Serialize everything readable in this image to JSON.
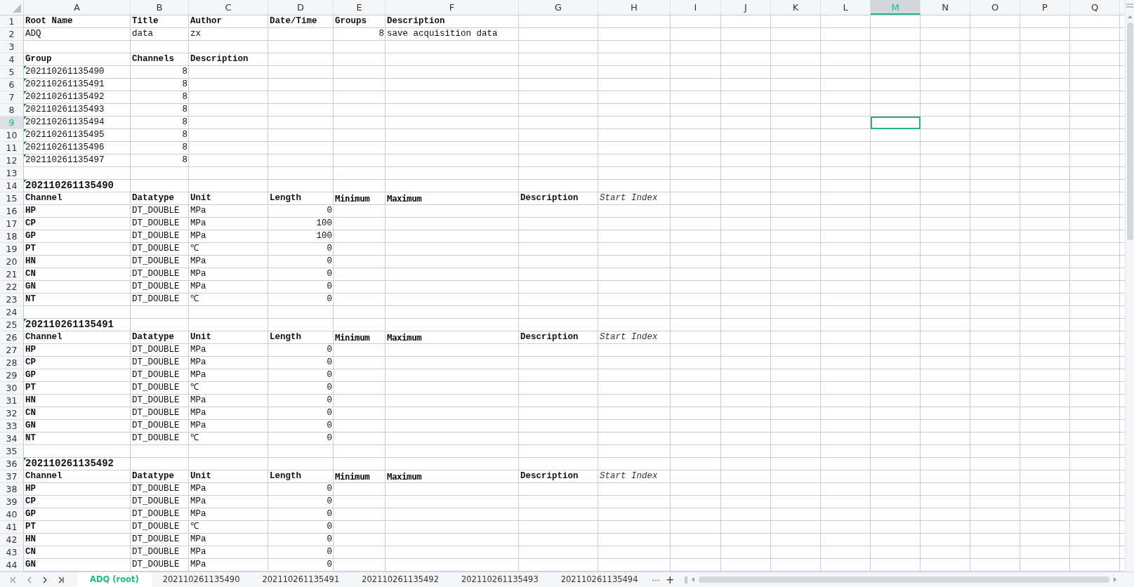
{
  "columns": [
    {
      "label": "A",
      "selected": false
    },
    {
      "label": "B",
      "selected": false
    },
    {
      "label": "C",
      "selected": false
    },
    {
      "label": "D",
      "selected": false
    },
    {
      "label": "E",
      "selected": false
    },
    {
      "label": "F",
      "selected": false
    },
    {
      "label": "G",
      "selected": false
    },
    {
      "label": "H",
      "selected": false
    },
    {
      "label": "I",
      "selected": false
    },
    {
      "label": "J",
      "selected": false
    },
    {
      "label": "K",
      "selected": false
    },
    {
      "label": "L",
      "selected": false
    },
    {
      "label": "M",
      "selected": true
    },
    {
      "label": "N",
      "selected": false
    },
    {
      "label": "O",
      "selected": false
    },
    {
      "label": "P",
      "selected": false
    },
    {
      "label": "Q",
      "selected": false
    }
  ],
  "rows": [
    {
      "label": "1",
      "selected": false,
      "cells": [
        {
          "text": "Root Name",
          "kind": "bold",
          "flagged": false
        },
        {
          "text": "Title",
          "kind": "bold",
          "flagged": false
        },
        {
          "text": "Author",
          "kind": "bold",
          "flagged": false
        },
        {
          "text": "Date/Time",
          "kind": "bold",
          "flagged": false
        },
        {
          "text": "Groups",
          "kind": "bold",
          "flagged": false
        },
        {
          "text": "Description",
          "kind": "bold",
          "flagged": false
        }
      ]
    },
    {
      "label": "2",
      "selected": false,
      "cells": [
        {
          "text": "ADQ",
          "kind": "plain",
          "flagged": false
        },
        {
          "text": "data",
          "kind": "plain",
          "flagged": false
        },
        {
          "text": "zx",
          "kind": "plain",
          "flagged": false
        },
        null,
        {
          "text": "8",
          "kind": "num",
          "flagged": false
        },
        {
          "text": "save acquisition data",
          "kind": "plain",
          "flagged": false
        }
      ]
    },
    {
      "label": "3",
      "selected": false,
      "cells": []
    },
    {
      "label": "4",
      "selected": false,
      "cells": [
        {
          "text": "Group",
          "kind": "bold",
          "flagged": false
        },
        {
          "text": "Channels",
          "kind": "bold",
          "flagged": false
        },
        {
          "text": "Description",
          "kind": "bold",
          "flagged": false
        }
      ]
    },
    {
      "label": "5",
      "selected": false,
      "cells": [
        {
          "text": "202110261135490",
          "kind": "plain",
          "flagged": true
        },
        {
          "text": "8",
          "kind": "num",
          "flagged": false
        }
      ]
    },
    {
      "label": "6",
      "selected": false,
      "cells": [
        {
          "text": "202110261135491",
          "kind": "plain",
          "flagged": true
        },
        {
          "text": "8",
          "kind": "num",
          "flagged": false
        }
      ]
    },
    {
      "label": "7",
      "selected": false,
      "cells": [
        {
          "text": "202110261135492",
          "kind": "plain",
          "flagged": true
        },
        {
          "text": "8",
          "kind": "num",
          "flagged": false
        }
      ]
    },
    {
      "label": "8",
      "selected": false,
      "cells": [
        {
          "text": "202110261135493",
          "kind": "plain",
          "flagged": true
        },
        {
          "text": "8",
          "kind": "num",
          "flagged": false
        }
      ]
    },
    {
      "label": "9",
      "selected": true,
      "cells": [
        {
          "text": "202110261135494",
          "kind": "plain",
          "flagged": true
        },
        {
          "text": "8",
          "kind": "num",
          "flagged": false
        }
      ]
    },
    {
      "label": "10",
      "selected": false,
      "cells": [
        {
          "text": "202110261135495",
          "kind": "plain",
          "flagged": true
        },
        {
          "text": "8",
          "kind": "num",
          "flagged": false
        }
      ]
    },
    {
      "label": "11",
      "selected": false,
      "cells": [
        {
          "text": "202110261135496",
          "kind": "plain",
          "flagged": true
        },
        {
          "text": "8",
          "kind": "num",
          "flagged": false
        }
      ]
    },
    {
      "label": "12",
      "selected": false,
      "cells": [
        {
          "text": "202110261135497",
          "kind": "plain",
          "flagged": true
        },
        {
          "text": "8",
          "kind": "num",
          "flagged": false
        }
      ]
    },
    {
      "label": "13",
      "selected": false,
      "cells": []
    },
    {
      "label": "14",
      "selected": false,
      "cells": [
        {
          "text": "202110261135490",
          "kind": "title",
          "flagged": true
        }
      ]
    },
    {
      "label": "15",
      "selected": false,
      "cells": [
        {
          "text": "Channel",
          "kind": "bold",
          "flagged": false
        },
        {
          "text": "Datatype",
          "kind": "bold",
          "flagged": false
        },
        {
          "text": "Unit",
          "kind": "bold",
          "flagged": false
        },
        {
          "text": "Length",
          "kind": "bold",
          "flagged": false
        },
        {
          "text": "Minimum",
          "kind": "heavy",
          "flagged": false
        },
        {
          "text": "Maximum",
          "kind": "heavy",
          "flagged": false
        },
        {
          "text": "Description",
          "kind": "bold",
          "flagged": false
        },
        {
          "text": "Start Index",
          "kind": "italic",
          "flagged": false
        }
      ]
    },
    {
      "label": "16",
      "selected": false,
      "cells": [
        {
          "text": "HP",
          "kind": "bold",
          "flagged": false
        },
        {
          "text": "DT_DOUBLE",
          "kind": "plain",
          "flagged": false
        },
        {
          "text": "MPa",
          "kind": "plain",
          "flagged": false
        },
        {
          "text": "0",
          "kind": "num",
          "flagged": false
        }
      ]
    },
    {
      "label": "17",
      "selected": false,
      "cells": [
        {
          "text": "CP",
          "kind": "bold",
          "flagged": false
        },
        {
          "text": "DT_DOUBLE",
          "kind": "plain",
          "flagged": false
        },
        {
          "text": "MPa",
          "kind": "plain",
          "flagged": false
        },
        {
          "text": "100",
          "kind": "num",
          "flagged": false
        }
      ]
    },
    {
      "label": "18",
      "selected": false,
      "cells": [
        {
          "text": "GP",
          "kind": "bold",
          "flagged": false
        },
        {
          "text": "DT_DOUBLE",
          "kind": "plain",
          "flagged": false
        },
        {
          "text": "MPa",
          "kind": "plain",
          "flagged": false
        },
        {
          "text": "100",
          "kind": "num",
          "flagged": false
        }
      ]
    },
    {
      "label": "19",
      "selected": false,
      "cells": [
        {
          "text": "PT",
          "kind": "bold",
          "flagged": false
        },
        {
          "text": "DT_DOUBLE",
          "kind": "plain",
          "flagged": false
        },
        {
          "text": "℃",
          "kind": "plain",
          "flagged": false
        },
        {
          "text": "0",
          "kind": "num",
          "flagged": false
        }
      ]
    },
    {
      "label": "20",
      "selected": false,
      "cells": [
        {
          "text": "HN",
          "kind": "bold",
          "flagged": false
        },
        {
          "text": "DT_DOUBLE",
          "kind": "plain",
          "flagged": false
        },
        {
          "text": "MPa",
          "kind": "plain",
          "flagged": false
        },
        {
          "text": "0",
          "kind": "num",
          "flagged": false
        }
      ]
    },
    {
      "label": "21",
      "selected": false,
      "cells": [
        {
          "text": "CN",
          "kind": "bold",
          "flagged": false
        },
        {
          "text": "DT_DOUBLE",
          "kind": "plain",
          "flagged": false
        },
        {
          "text": "MPa",
          "kind": "plain",
          "flagged": false
        },
        {
          "text": "0",
          "kind": "num",
          "flagged": false
        }
      ]
    },
    {
      "label": "22",
      "selected": false,
      "cells": [
        {
          "text": "GN",
          "kind": "bold",
          "flagged": false
        },
        {
          "text": "DT_DOUBLE",
          "kind": "plain",
          "flagged": false
        },
        {
          "text": "MPa",
          "kind": "plain",
          "flagged": false
        },
        {
          "text": "0",
          "kind": "num",
          "flagged": false
        }
      ]
    },
    {
      "label": "23",
      "selected": false,
      "cells": [
        {
          "text": "NT",
          "kind": "bold",
          "flagged": false
        },
        {
          "text": "DT_DOUBLE",
          "kind": "plain",
          "flagged": false
        },
        {
          "text": "℃",
          "kind": "plain",
          "flagged": false
        },
        {
          "text": "0",
          "kind": "num",
          "flagged": false
        }
      ]
    },
    {
      "label": "24",
      "selected": false,
      "cells": []
    },
    {
      "label": "25",
      "selected": false,
      "cells": [
        {
          "text": "202110261135491",
          "kind": "title",
          "flagged": true
        }
      ]
    },
    {
      "label": "26",
      "selected": false,
      "cells": [
        {
          "text": "Channel",
          "kind": "bold",
          "flagged": false
        },
        {
          "text": "Datatype",
          "kind": "bold",
          "flagged": false
        },
        {
          "text": "Unit",
          "kind": "bold",
          "flagged": false
        },
        {
          "text": "Length",
          "kind": "bold",
          "flagged": false
        },
        {
          "text": "Minimum",
          "kind": "heavy",
          "flagged": false
        },
        {
          "text": "Maximum",
          "kind": "heavy",
          "flagged": false
        },
        {
          "text": "Description",
          "kind": "bold",
          "flagged": false
        },
        {
          "text": "Start Index",
          "kind": "italic",
          "flagged": false
        }
      ]
    },
    {
      "label": "27",
      "selected": false,
      "cells": [
        {
          "text": "HP",
          "kind": "bold",
          "flagged": false
        },
        {
          "text": "DT_DOUBLE",
          "kind": "plain",
          "flagged": false
        },
        {
          "text": "MPa",
          "kind": "plain",
          "flagged": false
        },
        {
          "text": "0",
          "kind": "num",
          "flagged": false
        }
      ]
    },
    {
      "label": "28",
      "selected": false,
      "cells": [
        {
          "text": "CP",
          "kind": "bold",
          "flagged": false
        },
        {
          "text": "DT_DOUBLE",
          "kind": "plain",
          "flagged": false
        },
        {
          "text": "MPa",
          "kind": "plain",
          "flagged": false
        },
        {
          "text": "0",
          "kind": "num",
          "flagged": false
        }
      ]
    },
    {
      "label": "29",
      "selected": false,
      "cells": [
        {
          "text": "GP",
          "kind": "bold",
          "flagged": false
        },
        {
          "text": "DT_DOUBLE",
          "kind": "plain",
          "flagged": false
        },
        {
          "text": "MPa",
          "kind": "plain",
          "flagged": false
        },
        {
          "text": "0",
          "kind": "num",
          "flagged": false
        }
      ]
    },
    {
      "label": "30",
      "selected": false,
      "cells": [
        {
          "text": "PT",
          "kind": "bold",
          "flagged": false
        },
        {
          "text": "DT_DOUBLE",
          "kind": "plain",
          "flagged": false
        },
        {
          "text": "℃",
          "kind": "plain",
          "flagged": false
        },
        {
          "text": "0",
          "kind": "num",
          "flagged": false
        }
      ]
    },
    {
      "label": "31",
      "selected": false,
      "cells": [
        {
          "text": "HN",
          "kind": "bold",
          "flagged": false
        },
        {
          "text": "DT_DOUBLE",
          "kind": "plain",
          "flagged": false
        },
        {
          "text": "MPa",
          "kind": "plain",
          "flagged": false
        },
        {
          "text": "0",
          "kind": "num",
          "flagged": false
        }
      ]
    },
    {
      "label": "32",
      "selected": false,
      "cells": [
        {
          "text": "CN",
          "kind": "bold",
          "flagged": false
        },
        {
          "text": "DT_DOUBLE",
          "kind": "plain",
          "flagged": false
        },
        {
          "text": "MPa",
          "kind": "plain",
          "flagged": false
        },
        {
          "text": "0",
          "kind": "num",
          "flagged": false
        }
      ]
    },
    {
      "label": "33",
      "selected": false,
      "cells": [
        {
          "text": "GN",
          "kind": "bold",
          "flagged": false
        },
        {
          "text": "DT_DOUBLE",
          "kind": "plain",
          "flagged": false
        },
        {
          "text": "MPa",
          "kind": "plain",
          "flagged": false
        },
        {
          "text": "0",
          "kind": "num",
          "flagged": false
        }
      ]
    },
    {
      "label": "34",
      "selected": false,
      "cells": [
        {
          "text": "NT",
          "kind": "bold",
          "flagged": false
        },
        {
          "text": "DT_DOUBLE",
          "kind": "plain",
          "flagged": false
        },
        {
          "text": "℃",
          "kind": "plain",
          "flagged": false
        },
        {
          "text": "0",
          "kind": "num",
          "flagged": false
        }
      ]
    },
    {
      "label": "35",
      "selected": false,
      "cells": []
    },
    {
      "label": "36",
      "selected": false,
      "cells": [
        {
          "text": "202110261135492",
          "kind": "title",
          "flagged": true
        }
      ]
    },
    {
      "label": "37",
      "selected": false,
      "cells": [
        {
          "text": "Channel",
          "kind": "bold",
          "flagged": false
        },
        {
          "text": "Datatype",
          "kind": "bold",
          "flagged": false
        },
        {
          "text": "Unit",
          "kind": "bold",
          "flagged": false
        },
        {
          "text": "Length",
          "kind": "bold",
          "flagged": false
        },
        {
          "text": "Minimum",
          "kind": "heavy",
          "flagged": false
        },
        {
          "text": "Maximum",
          "kind": "heavy",
          "flagged": false
        },
        {
          "text": "Description",
          "kind": "bold",
          "flagged": false
        },
        {
          "text": "Start Index",
          "kind": "italic",
          "flagged": false
        }
      ]
    },
    {
      "label": "38",
      "selected": false,
      "cells": [
        {
          "text": "HP",
          "kind": "bold",
          "flagged": false
        },
        {
          "text": "DT_DOUBLE",
          "kind": "plain",
          "flagged": false
        },
        {
          "text": "MPa",
          "kind": "plain",
          "flagged": false
        },
        {
          "text": "0",
          "kind": "num",
          "flagged": false
        }
      ]
    },
    {
      "label": "39",
      "selected": false,
      "cells": [
        {
          "text": "CP",
          "kind": "bold",
          "flagged": false
        },
        {
          "text": "DT_DOUBLE",
          "kind": "plain",
          "flagged": false
        },
        {
          "text": "MPa",
          "kind": "plain",
          "flagged": false
        },
        {
          "text": "0",
          "kind": "num",
          "flagged": false
        }
      ]
    },
    {
      "label": "40",
      "selected": false,
      "cells": [
        {
          "text": "GP",
          "kind": "bold",
          "flagged": false
        },
        {
          "text": "DT_DOUBLE",
          "kind": "plain",
          "flagged": false
        },
        {
          "text": "MPa",
          "kind": "plain",
          "flagged": false
        },
        {
          "text": "0",
          "kind": "num",
          "flagged": false
        }
      ]
    },
    {
      "label": "41",
      "selected": false,
      "cells": [
        {
          "text": "PT",
          "kind": "bold",
          "flagged": false
        },
        {
          "text": "DT_DOUBLE",
          "kind": "plain",
          "flagged": false
        },
        {
          "text": "℃",
          "kind": "plain",
          "flagged": false
        },
        {
          "text": "0",
          "kind": "num",
          "flagged": false
        }
      ]
    },
    {
      "label": "42",
      "selected": false,
      "cells": [
        {
          "text": "HN",
          "kind": "bold",
          "flagged": false
        },
        {
          "text": "DT_DOUBLE",
          "kind": "plain",
          "flagged": false
        },
        {
          "text": "MPa",
          "kind": "plain",
          "flagged": false
        },
        {
          "text": "0",
          "kind": "num",
          "flagged": false
        }
      ]
    },
    {
      "label": "43",
      "selected": false,
      "cells": [
        {
          "text": "CN",
          "kind": "bold",
          "flagged": false
        },
        {
          "text": "DT_DOUBLE",
          "kind": "plain",
          "flagged": false
        },
        {
          "text": "MPa",
          "kind": "plain",
          "flagged": false
        },
        {
          "text": "0",
          "kind": "num",
          "flagged": false
        }
      ]
    },
    {
      "label": "44",
      "selected": false,
      "cells": [
        {
          "text": "GN",
          "kind": "bold",
          "flagged": false
        },
        {
          "text": "DT_DOUBLE",
          "kind": "plain",
          "flagged": false
        },
        {
          "text": "MPa",
          "kind": "plain",
          "flagged": false
        },
        {
          "text": "0",
          "kind": "num",
          "flagged": false
        }
      ]
    }
  ],
  "sheet_tabs": [
    {
      "label": "ADQ (root)",
      "selected": true
    },
    {
      "label": "202110261135490",
      "selected": false
    },
    {
      "label": "202110261135491",
      "selected": false
    },
    {
      "label": "202110261135492",
      "selected": false
    },
    {
      "label": "202110261135493",
      "selected": false
    },
    {
      "label": "202110261135494",
      "selected": false
    }
  ],
  "more_tabs": "⋯",
  "add_tab": "+"
}
